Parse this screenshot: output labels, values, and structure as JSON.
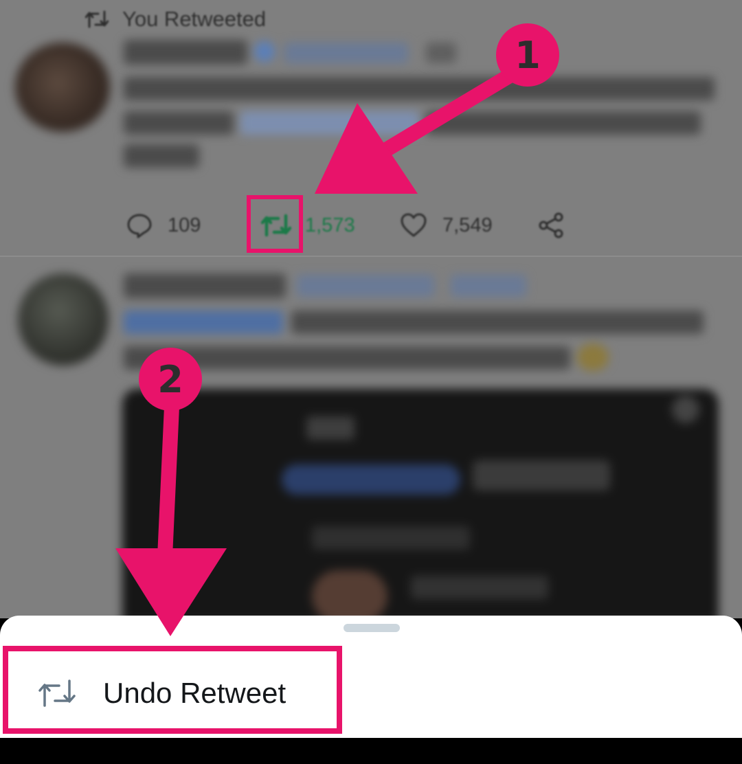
{
  "timeline": {
    "retweet_context": "You Retweeted",
    "tweet1": {
      "actions": {
        "replies": "109",
        "retweets": "1,573",
        "likes": "7,549"
      },
      "retweet_active_color": "#1b7a48"
    }
  },
  "annotations": {
    "color": "#e8136a",
    "step1": "1",
    "step2": "2"
  },
  "bottom_sheet": {
    "undo_retweet_label": "Undo Retweet"
  },
  "icons": {
    "context": "retweet-icon",
    "reply": "comment-icon",
    "retweet": "retweet-icon",
    "like": "heart-icon",
    "share": "share-icon",
    "undo": "retweet-icon"
  }
}
